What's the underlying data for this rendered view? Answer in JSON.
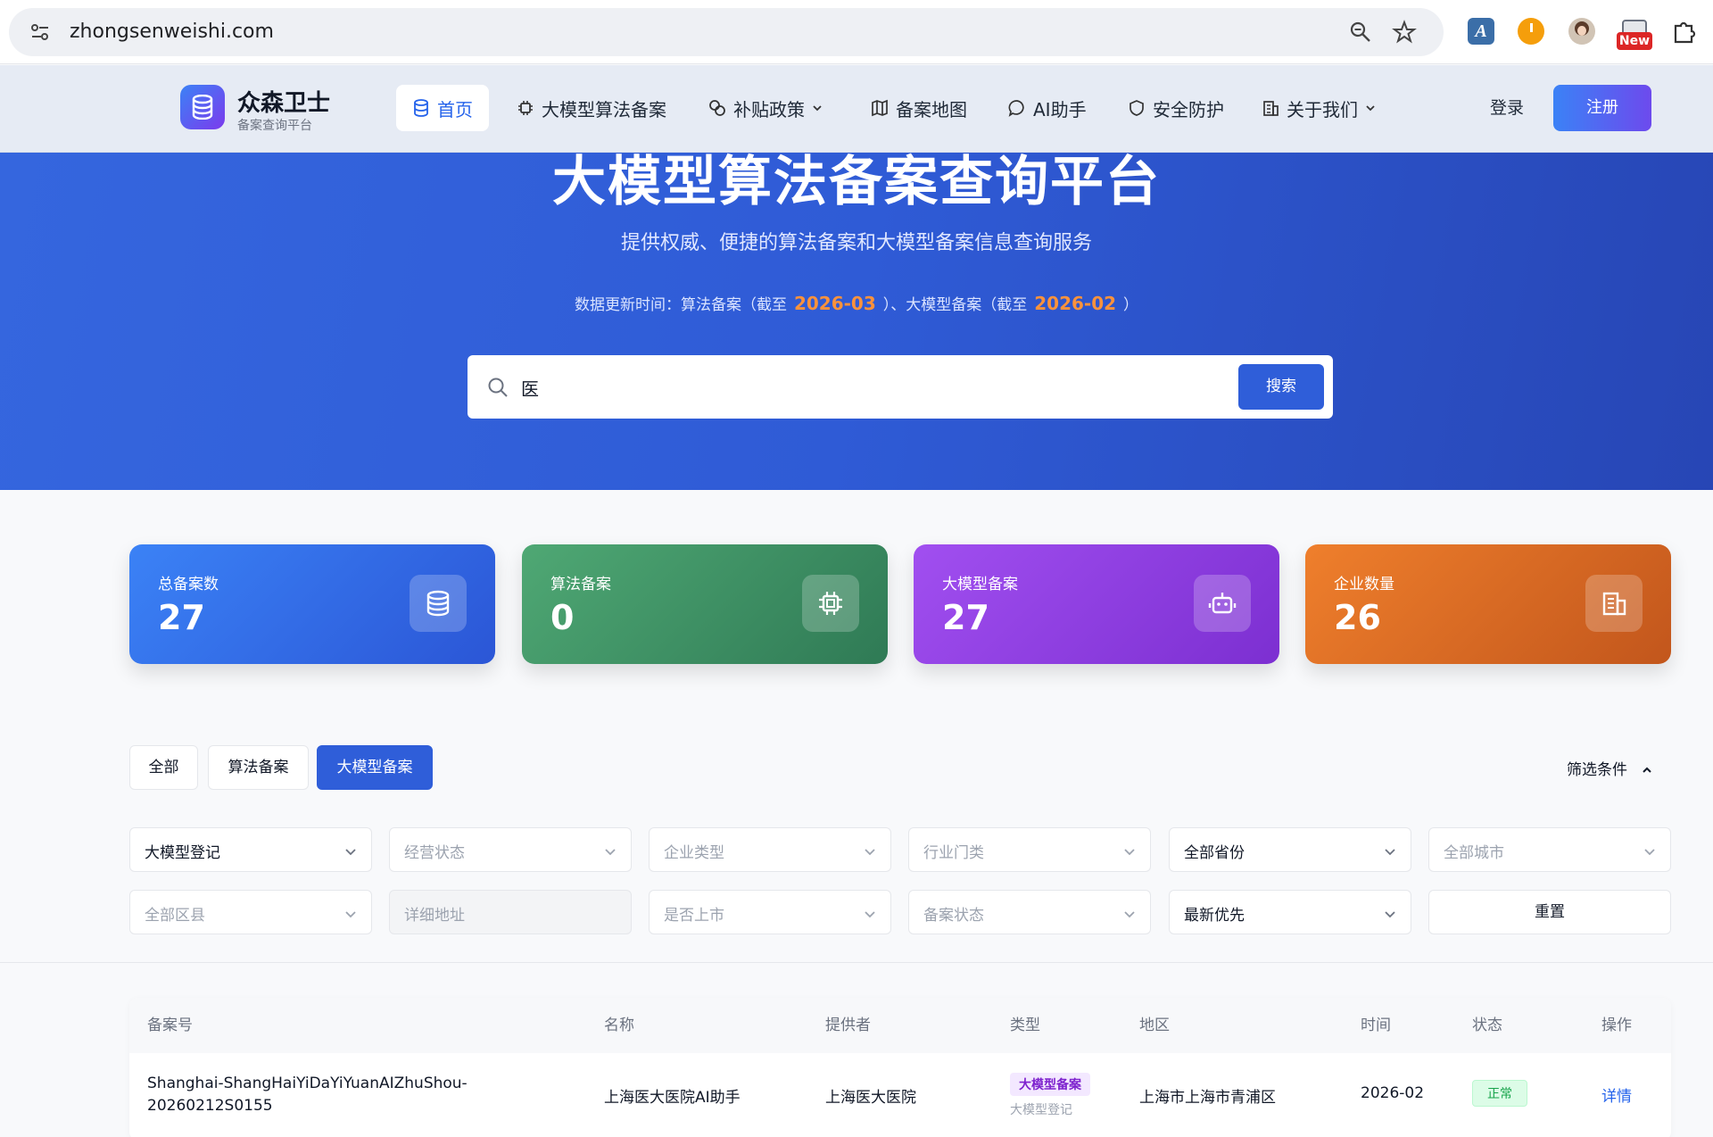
{
  "browser": {
    "url": "zhongsenweishi.com",
    "ext_new_badge": "New"
  },
  "brand": {
    "name": "众森卫士",
    "subtitle": "备案查询平台"
  },
  "nav": {
    "items": [
      {
        "label": "首页",
        "icon": "database-icon",
        "active": true
      },
      {
        "label": "大模型算法备案",
        "icon": "chip-icon"
      },
      {
        "label": "补贴政策",
        "icon": "coins-icon",
        "dropdown": true
      },
      {
        "label": "备案地图",
        "icon": "map-icon"
      },
      {
        "label": "AI助手",
        "icon": "chat-icon"
      },
      {
        "label": "安全防护",
        "icon": "shield-icon"
      },
      {
        "label": "关于我们",
        "icon": "building-icon",
        "dropdown": true
      }
    ],
    "login": "登录",
    "register": "注册"
  },
  "hero": {
    "title": "大模型算法备案查询平台",
    "subtitle": "提供权威、便捷的算法备案和大模型备案信息查询服务",
    "update_prefix": "数据更新时间：算法备案（截至",
    "algo_date": "2026-03",
    "update_mid": "）、大模型备案（截至",
    "llm_date": "2026-02",
    "update_suffix": "）"
  },
  "search": {
    "value": "医",
    "button": "搜索"
  },
  "stats": [
    {
      "label": "总备案数",
      "value": "27",
      "icon": "database-icon"
    },
    {
      "label": "算法备案",
      "value": "0",
      "icon": "chip-icon"
    },
    {
      "label": "大模型备案",
      "value": "27",
      "icon": "robot-icon"
    },
    {
      "label": "企业数量",
      "value": "26",
      "icon": "building-icon"
    }
  ],
  "tabs": {
    "all": "全部",
    "algo": "算法备案",
    "llm": "大模型备案",
    "filter_toggle": "筛选条件"
  },
  "filters": {
    "registration_type": "大模型登记",
    "business_status": "经营状态",
    "company_type": "企业类型",
    "industry": "行业门类",
    "province": "全部省份",
    "city": "全部城市",
    "district": "全部区县",
    "address": "详细地址",
    "listed": "是否上市",
    "filing_status": "备案状态",
    "sort": "最新优先",
    "reset": "重置"
  },
  "table": {
    "headers": [
      "备案号",
      "名称",
      "提供者",
      "类型",
      "地区",
      "时间",
      "状态",
      "操作"
    ],
    "rows": [
      {
        "filing_no_line1": "Shanghai-ShangHaiYiDaYiYuanAIZhuShou-",
        "filing_no_line2": "20260212S0155",
        "name": "上海医大医院AI助手",
        "provider": "上海医大医院",
        "type": "大模型备案",
        "type_sub": "大模型登记",
        "region": "上海市上海市青浦区",
        "time": "2026-02",
        "status": "正常",
        "action": "详情"
      }
    ]
  }
}
